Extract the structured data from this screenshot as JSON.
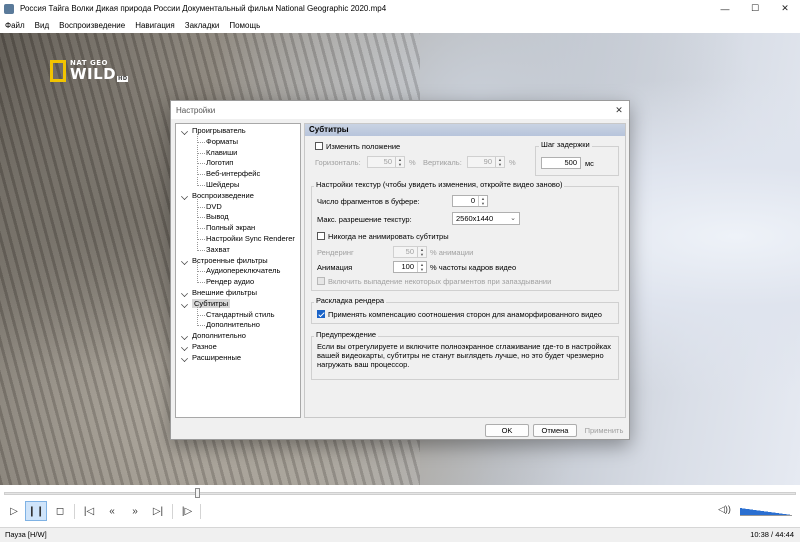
{
  "window": {
    "title": "Россия Тайга Волки Дикая природа России Документальный фильм National Geographic 2020.mp4",
    "controls": [
      "—",
      "☐",
      "✕"
    ]
  },
  "menu": [
    "Файл",
    "Вид",
    "Воспроизведение",
    "Навигация",
    "Закладки",
    "Помощь"
  ],
  "video": {
    "logo": {
      "line1": "NAT GEO",
      "line2": "WILD",
      "badge": "HD"
    }
  },
  "dialog": {
    "title": "Настройки",
    "close": "✕",
    "tree": [
      {
        "label": "Проигрыватель",
        "level": 0
      },
      {
        "label": "Форматы",
        "level": 1
      },
      {
        "label": "Клавиши",
        "level": 1
      },
      {
        "label": "Логотип",
        "level": 1
      },
      {
        "label": "Веб-интерфейс",
        "level": 1
      },
      {
        "label": "Шейдеры",
        "level": 1
      },
      {
        "label": "Воспроизведение",
        "level": 0
      },
      {
        "label": "DVD",
        "level": 1
      },
      {
        "label": "Вывод",
        "level": 1
      },
      {
        "label": "Полный экран",
        "level": 1
      },
      {
        "label": "Настройки Sync Renderer",
        "level": 1
      },
      {
        "label": "Захват",
        "level": 1
      },
      {
        "label": "Встроенные фильтры",
        "level": 0
      },
      {
        "label": "Аудиопереключатель",
        "level": 1
      },
      {
        "label": "Рендер аудио",
        "level": 1
      },
      {
        "label": "Внешние фильтры",
        "level": 0
      },
      {
        "label": "Субтитры",
        "level": 0,
        "selected": true
      },
      {
        "label": "Стандартный стиль",
        "level": 1
      },
      {
        "label": "Дополнительно",
        "level": 1
      },
      {
        "label": "Дополнительно",
        "level": 0
      },
      {
        "label": "Разное",
        "level": 0
      },
      {
        "label": "Расширенные",
        "level": 0
      }
    ],
    "panel": {
      "header": "Субтитры",
      "position": {
        "checkbox_label": "Изменить положение",
        "horizontal_label": "Горизонталь:",
        "horizontal_value": "50",
        "vertical_label": "Вертикаль:",
        "vertical_value": "90",
        "percent": "%"
      },
      "delay": {
        "group_title": "Шаг задержки",
        "value": "500",
        "unit": "мс"
      },
      "texture": {
        "group_title": "Настройки текстур (чтобы увидеть изменения, откройте видео заново)",
        "buffer_label": "Число фрагментов в буфере:",
        "buffer_value": "0",
        "maxres_label": "Макс. разрешение текстур:",
        "maxres_value": "2560x1440",
        "no_anim_label": "Никогда не анимировать субтитры",
        "render_label": "Рендеринг",
        "render_value": "50",
        "render_suffix": "% анимации",
        "anim_label": "Анимация",
        "anim_value": "100",
        "anim_suffix": "% частоты кадров видео",
        "drop_label": "Включить выпадение некоторых фрагментов при запаздывании"
      },
      "render_layout": {
        "group_title": "Раскладка рендера",
        "compensation_label": "Применять компенсацию соотношения сторон для анаморфированного видео"
      },
      "warning": {
        "group_title": "Предупреждение",
        "text": "Если вы отрегулируете и включите полноэкранное сглаживание где-то в настройках вашей видеокарты, субтитры не станут выглядеть лучше, но это будет чрезмерно нагружать ваш процессор."
      }
    },
    "buttons": {
      "ok": "OK",
      "cancel": "Отмена",
      "apply": "Применить"
    }
  },
  "player": {
    "seek_progress": 0.243,
    "volume": 1.0,
    "status_left": "Пауза [H/W]",
    "status_right": "10:38 / 44:44"
  }
}
